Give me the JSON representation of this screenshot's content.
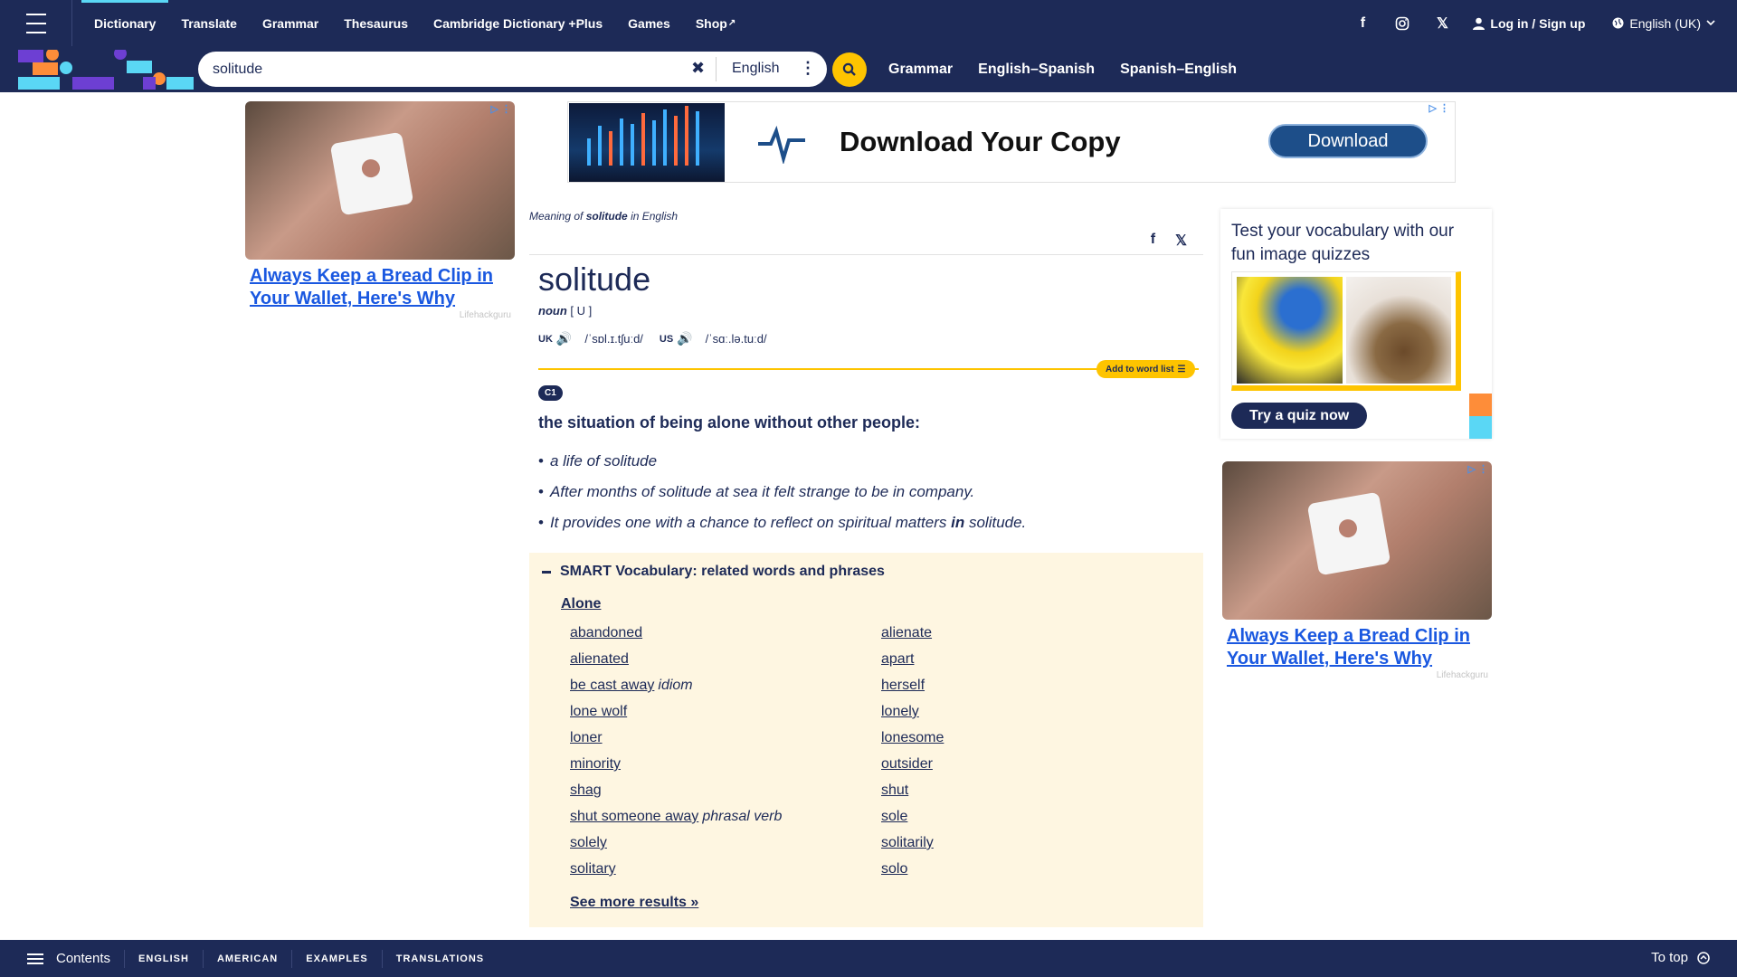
{
  "nav": {
    "items": [
      {
        "label": "Dictionary"
      },
      {
        "label": "Translate"
      },
      {
        "label": "Grammar"
      },
      {
        "label": "Thesaurus"
      },
      {
        "label": "Cambridge Dictionary +Plus"
      },
      {
        "label": "Games"
      },
      {
        "label": "Shop"
      }
    ],
    "login": "Log in / Sign up",
    "language": "English (UK)"
  },
  "search": {
    "value": "solitude",
    "dictionary_select": "English",
    "quick_links": [
      "Grammar",
      "English–Spanish",
      "Spanish–English"
    ]
  },
  "ads": {
    "side_title": "Always Keep a Bread Clip in Your Wallet, Here's Why",
    "side_source": "Lifehackguru",
    "banner_headline": "Download Your Copy",
    "banner_button": "Download"
  },
  "entry": {
    "meaning_prefix": "Meaning of ",
    "meaning_word": "solitude",
    "meaning_suffix": " in English",
    "headword": "solitude",
    "pos": "noun",
    "grammar": "[ U ]",
    "uk_label": "UK",
    "uk_ipa": "/ˈsɒl.ɪ.tʃuːd/",
    "us_label": "US",
    "us_ipa": "/ˈsɑː.lə.tuːd/",
    "add_to_word_list": "Add to word list",
    "level": "C1",
    "definition": "the situation of being alone without other people:",
    "examples": [
      {
        "text": "a life of solitude"
      },
      {
        "text": "After months of solitude at sea it felt strange to be in company."
      },
      {
        "pre": "It provides one with a chance to reflect on spiritual matters ",
        "bold": "in",
        "post": " solitude."
      }
    ]
  },
  "smart_vocab": {
    "heading": "SMART Vocabulary: related words and phrases",
    "category": "Alone",
    "left": [
      {
        "word": "abandoned",
        "tag": ""
      },
      {
        "word": "alienated",
        "tag": ""
      },
      {
        "word": "be cast away",
        "tag": "idiom"
      },
      {
        "word": "lone wolf",
        "tag": ""
      },
      {
        "word": "loner",
        "tag": ""
      },
      {
        "word": "minority",
        "tag": ""
      },
      {
        "word": "shag",
        "tag": ""
      },
      {
        "word": "shut someone away",
        "tag": "phrasal verb"
      },
      {
        "word": "solely",
        "tag": ""
      },
      {
        "word": "solitary",
        "tag": ""
      }
    ],
    "right": [
      {
        "word": "alienate",
        "tag": ""
      },
      {
        "word": "apart",
        "tag": ""
      },
      {
        "word": "herself",
        "tag": ""
      },
      {
        "word": "lonely",
        "tag": ""
      },
      {
        "word": "lonesome",
        "tag": ""
      },
      {
        "word": "outsider",
        "tag": ""
      },
      {
        "word": "shut",
        "tag": ""
      },
      {
        "word": "sole",
        "tag": ""
      },
      {
        "word": "solitarily",
        "tag": ""
      },
      {
        "word": "solo",
        "tag": ""
      }
    ],
    "see_more": "See more results »"
  },
  "quiz": {
    "title": "Test your vocabulary with our fun image quizzes",
    "button": "Try a quiz now"
  },
  "bottom": {
    "contents": "Contents",
    "tabs": [
      "ENGLISH",
      "AMERICAN",
      "EXAMPLES",
      "TRANSLATIONS"
    ],
    "to_top": "To top"
  },
  "colors": {
    "brand": "#1d2a57",
    "accent": "#fec400",
    "link_ad": "#1a58e0",
    "smart_bg": "#fef6e1"
  }
}
